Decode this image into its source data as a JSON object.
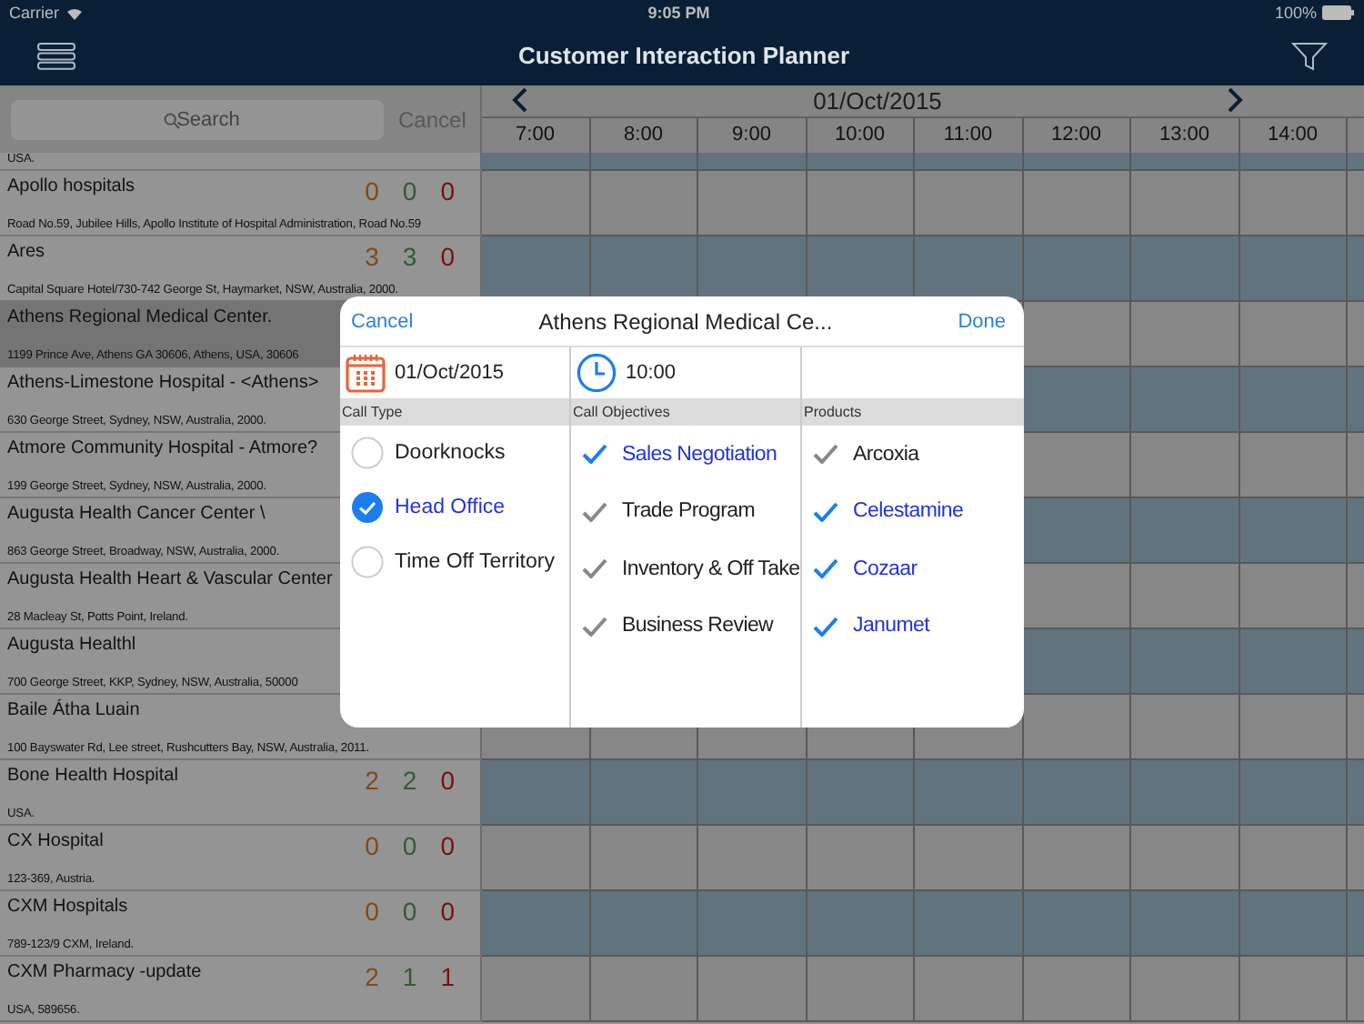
{
  "status_bar": {
    "carrier": "Carrier",
    "time": "9:05 PM",
    "battery": "100%"
  },
  "nav": {
    "title": "Customer Interaction Planner"
  },
  "search": {
    "placeholder": "Search",
    "cancel": "Cancel"
  },
  "calendar": {
    "date": "01/Oct/2015",
    "times": [
      "7:00",
      "8:00",
      "9:00",
      "10:00",
      "11:00",
      "12:00",
      "13:00",
      "14:00"
    ]
  },
  "customers": [
    {
      "address": "USA.",
      "selected": false,
      "highlighted": true
    },
    {
      "name": "Apollo hospitals",
      "address": "Road No.59, Jubilee Hills, Apollo Institute of Hospital Administration, Road No.59",
      "selected": false,
      "highlighted": false,
      "counts": [
        {
          "value": "0",
          "kind": "planned"
        },
        {
          "value": "0",
          "kind": "done"
        },
        {
          "value": "0",
          "kind": "missed"
        }
      ]
    },
    {
      "name": "Ares",
      "address": "Capital Square Hotel/730-742 George St, Haymarket, NSW, Australia, 2000.",
      "selected": false,
      "highlighted": true,
      "counts": [
        {
          "value": "3",
          "kind": "planned"
        },
        {
          "value": "3",
          "kind": "done"
        },
        {
          "value": "0",
          "kind": "missed"
        }
      ]
    },
    {
      "name": "Athens Regional Medical Center.",
      "address": "1199 Prince Ave, Athens GA 30606, Athens, USA, 30606",
      "selected": true,
      "highlighted": false
    },
    {
      "name": "Athens-Limestone Hospital - <Athens>",
      "address": "630 George Street, Sydney, NSW, Australia, 2000.",
      "selected": false,
      "highlighted": true
    },
    {
      "name": "Atmore Community Hospital - Atmore?",
      "address": "199 George Street, Sydney, NSW, Australia, 2000.",
      "selected": false,
      "highlighted": false
    },
    {
      "name": "Augusta Health Cancer Center \\",
      "address": "863 George Street, Broadway, NSW, Australia, 2000.",
      "selected": false,
      "highlighted": true
    },
    {
      "name": "Augusta Health Heart & Vascular Center",
      "address": "28 Macleay St, Potts Point, Ireland.",
      "selected": false,
      "highlighted": false
    },
    {
      "name": "Augusta Healthl",
      "address": "700 George Street, KKP, Sydney, NSW, Australia, 50000",
      "selected": false,
      "highlighted": true
    },
    {
      "name": "Baile Átha Luain",
      "address": "100 Bayswater Rd, Lee street, Rushcutters Bay, NSW, Australia, 2011.",
      "selected": false,
      "highlighted": false
    },
    {
      "name": "Bone Health Hospital",
      "address": "USA.",
      "selected": false,
      "highlighted": true,
      "counts": [
        {
          "value": "2",
          "kind": "planned"
        },
        {
          "value": "2",
          "kind": "done"
        },
        {
          "value": "0",
          "kind": "missed"
        }
      ]
    },
    {
      "name": "CX Hospital",
      "address": "123-369, Austria.",
      "selected": false,
      "highlighted": false,
      "counts": [
        {
          "value": "0",
          "kind": "planned"
        },
        {
          "value": "0",
          "kind": "done"
        },
        {
          "value": "0",
          "kind": "missed"
        }
      ]
    },
    {
      "name": "CXM Hospitals",
      "address": "789-123/9 CXM, Ireland.",
      "selected": false,
      "highlighted": true,
      "counts": [
        {
          "value": "0",
          "kind": "planned"
        },
        {
          "value": "0",
          "kind": "done"
        },
        {
          "value": "0",
          "kind": "missed"
        }
      ]
    },
    {
      "name": "CXM Pharmacy -update",
      "address": "USA, 589656.",
      "selected": false,
      "highlighted": false,
      "counts": [
        {
          "value": "2",
          "kind": "planned"
        },
        {
          "value": "1",
          "kind": "done"
        },
        {
          "value": "1",
          "kind": "missed"
        }
      ]
    }
  ],
  "popup": {
    "cancel": "Cancel",
    "title": "Athens Regional Medical Ce...",
    "done": "Done",
    "date": "01/Oct/2015",
    "time": "10:00",
    "call_type": {
      "header": "Call Type",
      "options": [
        {
          "label": "Doorknocks",
          "selected": false
        },
        {
          "label": "Head Office",
          "selected": true
        },
        {
          "label": "Time Off Territory",
          "selected": false
        }
      ]
    },
    "call_objectives": {
      "header": "Call Objectives",
      "items": [
        {
          "label": "Sales Negotiation",
          "checked": true
        },
        {
          "label": "Trade Program",
          "checked": false
        },
        {
          "label": "Inventory & Off Take",
          "checked": false
        },
        {
          "label": "Business Review",
          "checked": false
        }
      ]
    },
    "products": {
      "header": "Products",
      "items": [
        {
          "label": "Arcoxia",
          "checked": false
        },
        {
          "label": "Celestamine",
          "checked": true
        },
        {
          "label": "Cozaar",
          "checked": true
        },
        {
          "label": "Janumet",
          "checked": true
        }
      ]
    }
  }
}
